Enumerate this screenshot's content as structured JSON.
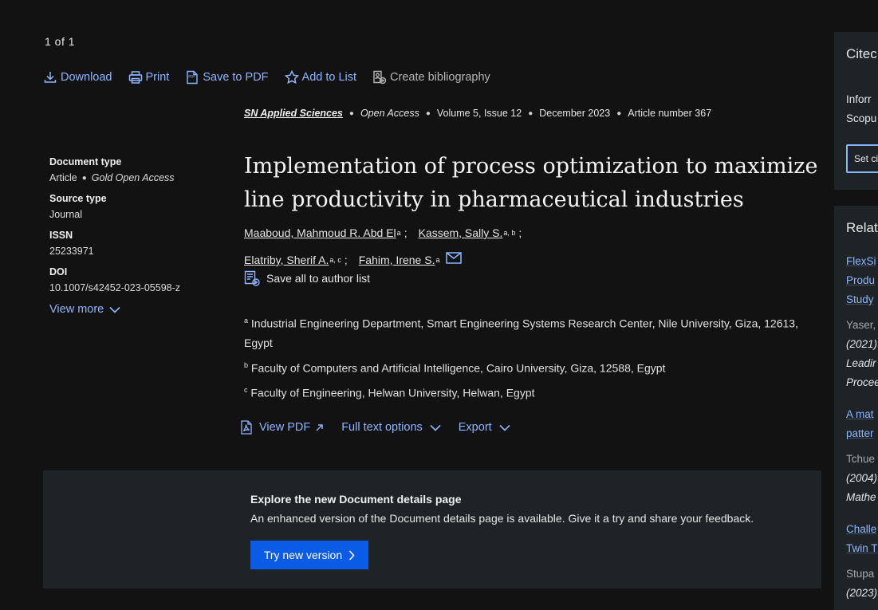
{
  "pager": {
    "text": "1 of 1"
  },
  "toolbar": {
    "download": "Download",
    "print": "Print",
    "save_pdf": "Save to PDF",
    "add_list": "Add to List",
    "create_bib": "Create bibliography"
  },
  "source": {
    "journal": "SN Applied Sciences",
    "access": "Open Access",
    "volume": "Volume 5, Issue 12",
    "date": "December 2023",
    "article": "Article number 367"
  },
  "meta": {
    "doc_type_label": "Document type",
    "doc_type_value": "Article",
    "doc_type_access": "Gold Open Access",
    "source_type_label": "Source type",
    "source_type_value": "Journal",
    "issn_label": "ISSN",
    "issn_value": "25233971",
    "doi_label": "DOI",
    "doi_value": "10.1007/s42452-023-05598-z",
    "view_more": "View more"
  },
  "article": {
    "title": "Implementation of process optimization to maximize line productivity in pharmaceutical industries"
  },
  "authors": [
    {
      "name": "Maaboud, Mahmoud R. Abd El",
      "sup": "a"
    },
    {
      "name": "Kassem, Sally S.",
      "sup": "a, b"
    },
    {
      "name": "Elatriby, Sherif A.",
      "sup": "a, c"
    },
    {
      "name": "Fahim, Irene S.",
      "sup": "a"
    }
  ],
  "save_all": "Save all to author list",
  "affiliations": [
    {
      "sup": "a",
      "text": "Industrial Engineering Department, Smart Engineering Systems Research Center, Nile University, Giza, 12613, Egypt"
    },
    {
      "sup": "b",
      "text": "Faculty of Computers and Artificial Intelligence, Cairo University, Giza, 12588, Egypt"
    },
    {
      "sup": "c",
      "text": "Faculty of Engineering, Helwan University, Helwan, Egypt"
    }
  ],
  "actions": {
    "view_pdf": "View PDF",
    "full_text": "Full text options",
    "export": "Export"
  },
  "banner": {
    "title": "Explore the new Document details page",
    "text": "An enhanced version of the Document details page is available. Give it a try and share your feedback.",
    "button": "Try new version"
  },
  "sidebar": {
    "card1_heading": "Citec",
    "card1_line1": "Inforr",
    "card1_line2": "Scopu",
    "card1_button": "Set ci",
    "card2_heading": "Relat",
    "items": [
      {
        "l1": "FlexSi",
        "l2": "Produ",
        "l3": "Study",
        "author": "Yaser,",
        "year": "(2021)",
        "j1": "Leadir",
        "j2": "Procee"
      },
      {
        "l1": "A mat",
        "l2": "patter",
        "author": "Tchue",
        "year": "(2004)",
        "j1": "Mathe"
      },
      {
        "l1": "Challe",
        "l2": "Twin T",
        "author": "Stupa",
        "year": "(2023)"
      }
    ]
  }
}
